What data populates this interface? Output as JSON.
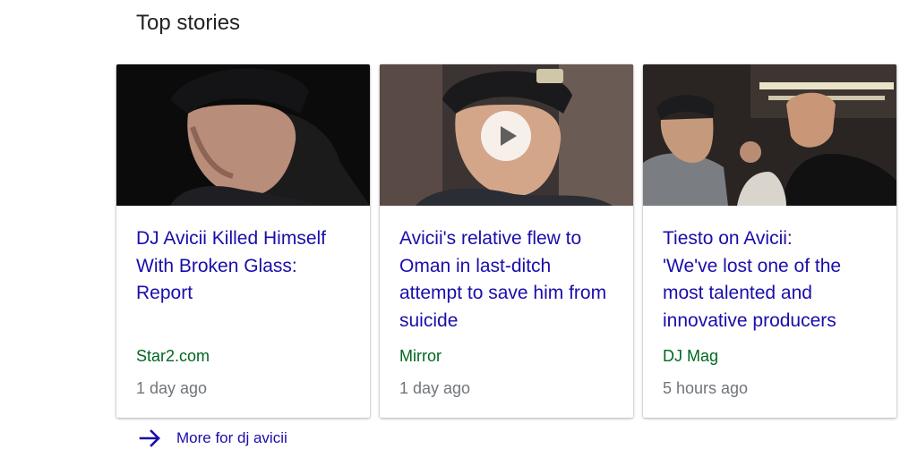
{
  "section": {
    "title": "Top stories"
  },
  "stories": [
    {
      "headline": "DJ Avicii Killed Himself With Broken Glass: Report",
      "source": "Star2.com",
      "age": "1 day ago",
      "has_video": false
    },
    {
      "headline": "Avicii's relative flew to Oman in last-ditch attempt to save him from suicide",
      "source": "Mirror",
      "age": "1 day ago",
      "has_video": true
    },
    {
      "headline": "Tiesto on Avicii:\n'We've lost one of the most talented and innovative producers",
      "source": "DJ Mag",
      "age": "5 hours ago",
      "has_video": false
    }
  ],
  "more": {
    "label": "More for dj avicii"
  },
  "colors": {
    "link": "#1a0dab",
    "source": "#006621",
    "meta": "#70757a",
    "title": "#222222"
  },
  "icons": {
    "play": "play-icon",
    "more": "arrow-right-icon"
  }
}
